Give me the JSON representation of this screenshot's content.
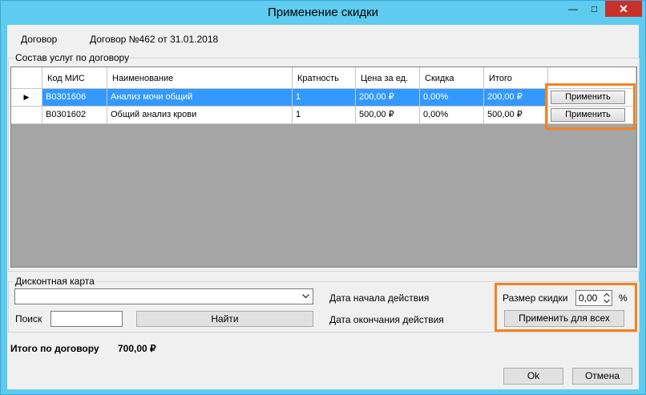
{
  "window": {
    "title": "Применение скидки",
    "minimize_glyph": "—",
    "maximize_glyph": "□",
    "close_glyph": "✕"
  },
  "contract": {
    "label": "Договор",
    "value": "Договор №462 от 31.01.2018"
  },
  "services_group": {
    "title": "Состав услуг по договору"
  },
  "grid": {
    "columns": [
      "Код МИС",
      "Наименование",
      "Кратность",
      "Цена за ед.",
      "Скидка",
      "Итого"
    ],
    "rows": [
      {
        "marker": "▶",
        "code": "B0301606",
        "name": "Анализ мочи общий",
        "multiplicity": "1",
        "price": "200,00 ₽",
        "discount": "0,00%",
        "total": "200,00 ₽",
        "action": "Применить",
        "selected": true
      },
      {
        "marker": "",
        "code": "B0301602",
        "name": "Общий  анализ крови",
        "multiplicity": "1",
        "price": "500,00 ₽",
        "discount": "0,00%",
        "total": "500,00 ₽",
        "action": "Применить",
        "selected": false
      }
    ]
  },
  "discount_card": {
    "title": "Дисконтная карта",
    "combo_value": "",
    "search_label": "Поиск",
    "search_value": "",
    "find_button": "Найти",
    "start_date_label": "Дата начала действия",
    "end_date_label": "Дата окончания действия"
  },
  "discount_size": {
    "label": "Размер скидки",
    "value": "0,00",
    "unit": "%",
    "apply_all_button": "Применить для всех"
  },
  "totals": {
    "label": "Итого по договору",
    "value": "700,00 ₽"
  },
  "footer": {
    "ok_button": "Ok",
    "cancel_button": "Отмена"
  },
  "colors": {
    "titlebar": "#5fcbee",
    "selection": "#3399ff",
    "highlight": "#f5821f",
    "close": "#c7312a"
  }
}
